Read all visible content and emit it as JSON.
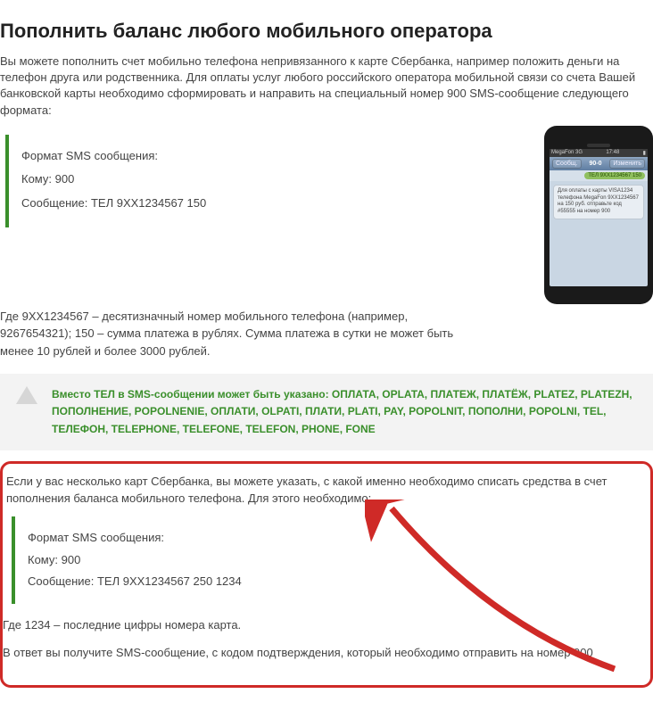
{
  "title": "Пополнить баланс любого мобильного оператора",
  "intro": "Вы можете пополнить счет мобильно телефона непривязанного к карте Сбербанка, например положить деньги на телефон друга или родственника. Для оплаты услуг любого  российского оператора мобильной связи со счета Вашей банковской карты необходимо сформировать и направить на специальный номер 900 SMS-сообщение следующего формата:",
  "sms1": {
    "format_label": "Формат SMS сообщения:",
    "to_label": "Кому: 900",
    "msg_label": "Сообщение:  ТЕЛ 9XX1234567 150"
  },
  "phone": {
    "status_left": "MegaFon 3G",
    "status_time": "17:48",
    "nav_back": "Сообщ.",
    "nav_title": "90-0",
    "nav_edit": "Изменить",
    "send_pill": "ТЕЛ 9XX1234567 150",
    "bubble": "Для оплаты с карты VISA1234 телефона MegaFon 9XX1234567 на 150 руб. отправьте код #55555 на номер 900"
  },
  "note1": "Где 9XX1234567 – десятизначный номер мобильного телефона (например, 9267654321); 150 – сумма платежа в рублях. Сумма платежа в сутки не может быть менее 10 рублей и более 3000 рублей.",
  "alt_text": "Вместо ТЕЛ в SMS-сообщении может быть указано: ОПЛАТА, OPLATA, ПЛАТЕЖ, ПЛАТЁЖ,  PLATEZ, PLATEZH, ПОПОЛНЕНИЕ, POPOLNENIE, ОПЛАТИ, OLPATI, ПЛАТИ, PLATI, PAY, POPOLNIT, ПОПОЛНИ, POPOLNI, TEL, ТЕЛЕФОН, TELEPHONE, TELEFONE, TELEFON, PHONE, FONE",
  "red": {
    "intro": "Если у вас несколько карт Сбербанка, вы можете указать, с какой именно необходимо списать средства в счет пополнения баланса мобильного телефона.  Для этого необходимо:",
    "sms": {
      "format_label": "Формат SMS сообщения:",
      "to_label": "Кому: 900",
      "msg_label": "Сообщение: ТЕЛ 9XX1234567 250 1234"
    },
    "note2": "Где 1234 – последние цифры номера карта.",
    "note3": "В ответ вы получите SMS-сообщение, с кодом подтверждения, который необходимо отправить на номер 900"
  }
}
